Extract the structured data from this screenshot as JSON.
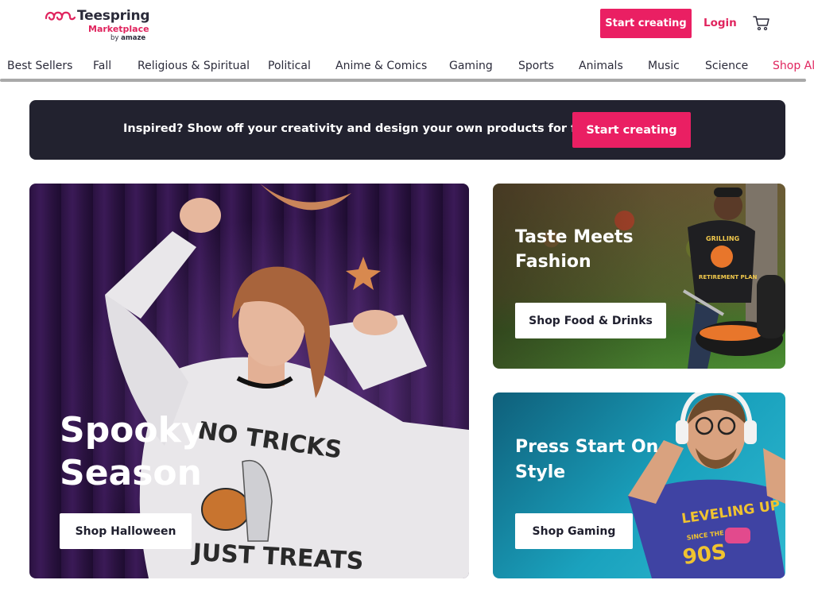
{
  "header": {
    "logo": {
      "name": "Teespring",
      "sub": "Marketplace",
      "by": "by",
      "by_brand": "amaze"
    },
    "start_creating_label": "Start creating",
    "login_label": "Login",
    "cart_icon": "cart-icon"
  },
  "categories": [
    "Best Sellers",
    "Fall",
    "Religious & Spiritual",
    "Political",
    "Anime & Comics",
    "Gaming",
    "Sports",
    "Animals",
    "Music",
    "Science",
    "Shop All"
  ],
  "promo": {
    "text": "Inspired? Show off your creativity and design your own products for free!",
    "button_label": "Start creating"
  },
  "cards": {
    "halloween": {
      "title": "Spooky Season",
      "button_label": "Shop Halloween",
      "shirt_text_top": "NO TRICKS",
      "shirt_text_bottom": "JUST TREATS"
    },
    "food": {
      "title": "Taste Meets Fashion",
      "button_label": "Shop Food & Drinks",
      "shirt_text_top": "GRILLING",
      "shirt_text_bottom": "RETIREMENT PLAN"
    },
    "gaming": {
      "title": "Press Start On Style",
      "button_label": "Shop Gaming",
      "shirt_text_top": "LEVELING UP",
      "shirt_text_mid": "SINCE THE",
      "shirt_text_bottom": "90S"
    }
  },
  "colors": {
    "accent": "#ea1f63",
    "dark": "#22222f",
    "text": "#2b2b3a"
  }
}
